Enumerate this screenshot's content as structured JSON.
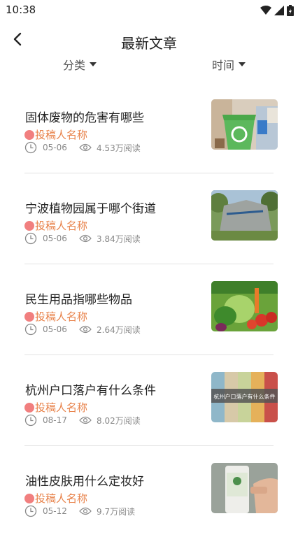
{
  "status": {
    "time": "10:38"
  },
  "header": {
    "title": "最新文章"
  },
  "filters": [
    {
      "label": "分类"
    },
    {
      "label": "时间"
    }
  ],
  "articles": [
    {
      "title": "固体废物的危害有哪些",
      "author": "投稿人名称",
      "date": "05-06",
      "views": "4.53万阅读",
      "image": "recycling-bin-image"
    },
    {
      "title": "宁波植物园属于哪个街道",
      "author": "投稿人名称",
      "date": "05-06",
      "views": "3.84万阅读",
      "image": "botanical-garden-rock-image"
    },
    {
      "title": "民生用品指哪些物品",
      "author": "投稿人名称",
      "date": "05-06",
      "views": "2.64万阅读",
      "image": "vegetables-image"
    },
    {
      "title": "杭州户口落户有什么条件",
      "author": "投稿人名称",
      "date": "08-17",
      "views": "8.02万阅读",
      "image": "colored-stripes-banner-image",
      "overlay_text": "杭州户口落户有什么条件"
    },
    {
      "title": "油性皮肤用什么定妆好",
      "author": "投稿人名称",
      "date": "05-12",
      "views": "9.7万阅读",
      "image": "cosmetic-bottle-image"
    }
  ]
}
